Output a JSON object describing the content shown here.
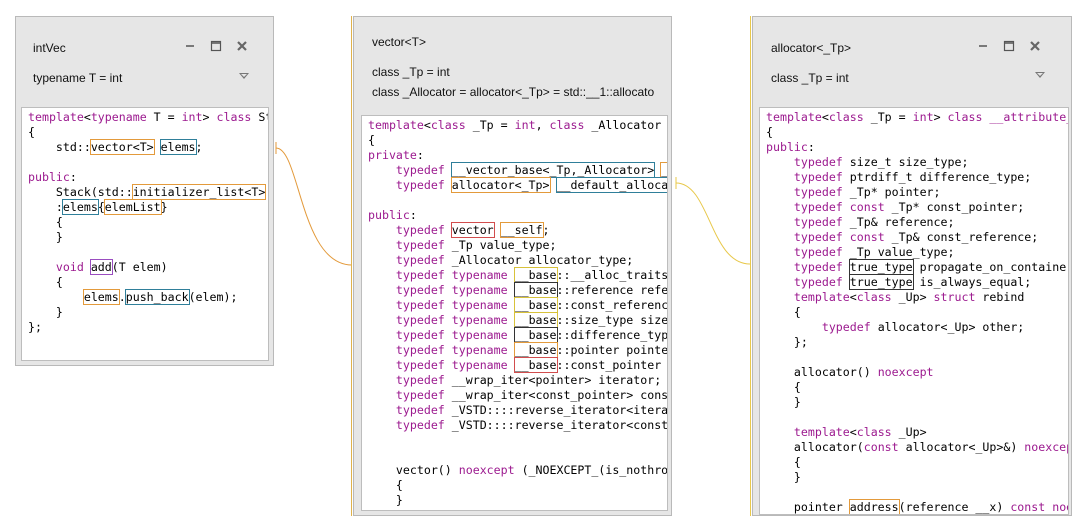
{
  "colors": {
    "panel_bg": "#e6e6e6",
    "keyword": "#9c1a8f",
    "orange_link": "#e39a3b",
    "yellow_link": "#e8c84a"
  },
  "panels": {
    "intvec": {
      "title": "intVec",
      "param": "typename T = int",
      "icons": [
        "minimize-icon",
        "maximize-icon",
        "close-icon",
        "chevron-down-icon"
      ]
    },
    "vector": {
      "title": "vector<T>",
      "params": [
        "class _Tp = int",
        "class _Allocator = allocator<_Tp> = std::__1::allocato"
      ]
    },
    "allocator": {
      "title": "allocator<_Tp>",
      "param": "class _Tp = int",
      "icons": [
        "minimize-icon",
        "maximize-icon",
        "close-icon",
        "chevron-down-icon"
      ]
    }
  },
  "code": {
    "intvec": [
      [
        [
          "template",
          "kw"
        ],
        [
          "<",
          ""
        ],
        [
          "typename",
          "kw"
        ],
        [
          " T = ",
          ""
        ],
        [
          "int",
          "kw"
        ],
        [
          "> ",
          ""
        ],
        [
          "class",
          "kw"
        ],
        [
          " Stack",
          ""
        ]
      ],
      [
        [
          "{",
          ""
        ]
      ],
      [
        [
          "    std::",
          ""
        ],
        [
          "vector<T>",
          "hl-o"
        ],
        [
          " ",
          ""
        ],
        [
          "elems",
          "hl-t"
        ],
        [
          ";",
          ""
        ]
      ],
      [
        [
          "",
          ""
        ]
      ],
      [
        [
          "public",
          "kw"
        ],
        [
          ":",
          ""
        ]
      ],
      [
        [
          "    Stack(std::",
          ""
        ],
        [
          "initializer_list<T>",
          "hl-o"
        ]
      ],
      [
        [
          "    :",
          ""
        ],
        [
          "elems",
          "hl-t"
        ],
        [
          "{",
          ""
        ],
        [
          "elemList",
          "hl-o"
        ],
        [
          "}",
          ""
        ]
      ],
      [
        [
          "    {",
          ""
        ]
      ],
      [
        [
          "    }",
          ""
        ]
      ],
      [
        [
          "",
          ""
        ]
      ],
      [
        [
          "    ",
          ""
        ],
        [
          "void",
          "kw"
        ],
        [
          " ",
          ""
        ],
        [
          "add",
          "hl-p"
        ],
        [
          "(T elem)",
          ""
        ]
      ],
      [
        [
          "    {",
          ""
        ]
      ],
      [
        [
          "        ",
          ""
        ],
        [
          "elems",
          "hl-o"
        ],
        [
          ".",
          ""
        ],
        [
          "push_back",
          "hl-t"
        ],
        [
          "(elem);",
          ""
        ]
      ],
      [
        [
          "    }",
          ""
        ]
      ],
      [
        [
          "};",
          ""
        ]
      ]
    ],
    "vector": [
      [
        [
          "template",
          "kw"
        ],
        [
          "<",
          ""
        ],
        [
          "class",
          "kw"
        ],
        [
          " _Tp = ",
          ""
        ],
        [
          "int",
          "kw"
        ],
        [
          ", ",
          ""
        ],
        [
          "class",
          "kw"
        ],
        [
          " _Allocator = allocator<_Tp>",
          ""
        ]
      ],
      [
        [
          "{",
          ""
        ]
      ],
      [
        [
          "private",
          "kw"
        ],
        [
          ":",
          ""
        ]
      ],
      [
        [
          "    ",
          ""
        ],
        [
          "typedef",
          "kw"
        ],
        [
          " ",
          ""
        ],
        [
          "__vector_base<_Tp,_Allocator>",
          "hl-t"
        ],
        [
          " ",
          ""
        ],
        [
          "__base",
          "hl-o"
        ],
        [
          ";",
          ""
        ]
      ],
      [
        [
          "    ",
          ""
        ],
        [
          "typedef",
          "kw"
        ],
        [
          " ",
          ""
        ],
        [
          "allocator<_Tp>",
          "hl-o"
        ],
        [
          " ",
          ""
        ],
        [
          "__default_allocator_type",
          "hl-t"
        ],
        [
          ";",
          ""
        ]
      ],
      [
        [
          "",
          ""
        ]
      ],
      [
        [
          "public",
          "kw"
        ],
        [
          ":",
          ""
        ]
      ],
      [
        [
          "    ",
          ""
        ],
        [
          "typedef",
          "kw"
        ],
        [
          " ",
          ""
        ],
        [
          "vector",
          "hl-r"
        ],
        [
          " ",
          ""
        ],
        [
          "__self",
          "hl-o"
        ],
        [
          ";",
          ""
        ]
      ],
      [
        [
          "    ",
          ""
        ],
        [
          "typedef",
          "kw"
        ],
        [
          " _Tp value_type;",
          ""
        ]
      ],
      [
        [
          "    ",
          ""
        ],
        [
          "typedef",
          "kw"
        ],
        [
          " _Allocator allocator_type;",
          ""
        ]
      ],
      [
        [
          "    ",
          ""
        ],
        [
          "typedef",
          "kw"
        ],
        [
          " ",
          ""
        ],
        [
          "typename",
          "kw"
        ],
        [
          " ",
          ""
        ],
        [
          "__base",
          "hl-y"
        ],
        [
          "::__alloc_traits __alloc_traits;",
          ""
        ]
      ],
      [
        [
          "    ",
          ""
        ],
        [
          "typedef",
          "kw"
        ],
        [
          " ",
          ""
        ],
        [
          "typename",
          "kw"
        ],
        [
          " ",
          ""
        ],
        [
          "__base",
          "hl-k"
        ],
        [
          "::reference reference;",
          ""
        ]
      ],
      [
        [
          "    ",
          ""
        ],
        [
          "typedef",
          "kw"
        ],
        [
          " ",
          ""
        ],
        [
          "typename",
          "kw"
        ],
        [
          " ",
          ""
        ],
        [
          "__base",
          "hl-y"
        ],
        [
          "::const_reference const_reference;",
          ""
        ]
      ],
      [
        [
          "    ",
          ""
        ],
        [
          "typedef",
          "kw"
        ],
        [
          " ",
          ""
        ],
        [
          "typename",
          "kw"
        ],
        [
          " ",
          ""
        ],
        [
          "__base",
          "hl-y"
        ],
        [
          "::size_type size_type;",
          ""
        ]
      ],
      [
        [
          "    ",
          ""
        ],
        [
          "typedef",
          "kw"
        ],
        [
          " ",
          ""
        ],
        [
          "typename",
          "kw"
        ],
        [
          " ",
          ""
        ],
        [
          "__base",
          "hl-k"
        ],
        [
          "::difference_type difference_type;",
          ""
        ]
      ],
      [
        [
          "    ",
          ""
        ],
        [
          "typedef",
          "kw"
        ],
        [
          " ",
          ""
        ],
        [
          "typename",
          "kw"
        ],
        [
          " ",
          ""
        ],
        [
          "__base",
          "hl-o"
        ],
        [
          "::pointer pointer;",
          ""
        ]
      ],
      [
        [
          "    ",
          ""
        ],
        [
          "typedef",
          "kw"
        ],
        [
          " ",
          ""
        ],
        [
          "typename",
          "kw"
        ],
        [
          " ",
          ""
        ],
        [
          "__base",
          "hl-r"
        ],
        [
          "::const_pointer const_pointer;",
          ""
        ]
      ],
      [
        [
          "    ",
          ""
        ],
        [
          "typedef",
          "kw"
        ],
        [
          " __wrap_iter<pointer> iterator;",
          ""
        ]
      ],
      [
        [
          "    ",
          ""
        ],
        [
          "typedef",
          "kw"
        ],
        [
          " __wrap_iter<const_pointer> const_iterator;",
          ""
        ]
      ],
      [
        [
          "    ",
          ""
        ],
        [
          "typedef",
          "kw"
        ],
        [
          " _VSTD::::reverse_iterator<iterator> reverse_iterator;",
          ""
        ]
      ],
      [
        [
          "    ",
          ""
        ],
        [
          "typedef",
          "kw"
        ],
        [
          " _VSTD::::reverse_iterator<const_iterator> const_reverse_iterator;",
          ""
        ]
      ],
      [
        [
          "",
          ""
        ]
      ],
      [
        [
          "",
          ""
        ]
      ],
      [
        [
          "    vector() ",
          ""
        ],
        [
          "noexcept",
          "kw"
        ],
        [
          " (_NOEXCEPT_(is_nothrow_default_constructible",
          ""
        ]
      ],
      [
        [
          "    {",
          ""
        ]
      ],
      [
        [
          "    }",
          ""
        ]
      ]
    ],
    "allocator": [
      [
        [
          "template",
          "kw"
        ],
        [
          "<",
          ""
        ],
        [
          "class",
          "kw"
        ],
        [
          " _Tp = ",
          ""
        ],
        [
          "int",
          "kw"
        ],
        [
          "> ",
          ""
        ],
        [
          "class",
          "kw"
        ],
        [
          " ",
          ""
        ],
        [
          "__attribute__",
          "kw"
        ]
      ],
      [
        [
          "{",
          ""
        ]
      ],
      [
        [
          "public",
          "kw"
        ],
        [
          ":",
          ""
        ]
      ],
      [
        [
          "    ",
          ""
        ],
        [
          "typedef",
          "kw"
        ],
        [
          " size_t size_type;",
          ""
        ]
      ],
      [
        [
          "    ",
          ""
        ],
        [
          "typedef",
          "kw"
        ],
        [
          " ptrdiff_t difference_type;",
          ""
        ]
      ],
      [
        [
          "    ",
          ""
        ],
        [
          "typedef",
          "kw"
        ],
        [
          " _Tp* pointer;",
          ""
        ]
      ],
      [
        [
          "    ",
          ""
        ],
        [
          "typedef",
          "kw"
        ],
        [
          " ",
          ""
        ],
        [
          "const",
          "kw"
        ],
        [
          " _Tp* const_pointer;",
          ""
        ]
      ],
      [
        [
          "    ",
          ""
        ],
        [
          "typedef",
          "kw"
        ],
        [
          " _Tp& reference;",
          ""
        ]
      ],
      [
        [
          "    ",
          ""
        ],
        [
          "typedef",
          "kw"
        ],
        [
          " ",
          ""
        ],
        [
          "const",
          "kw"
        ],
        [
          " _Tp& const_reference;",
          ""
        ]
      ],
      [
        [
          "    ",
          ""
        ],
        [
          "typedef",
          "kw"
        ],
        [
          " _Tp value_type;",
          ""
        ]
      ],
      [
        [
          "    ",
          ""
        ],
        [
          "typedef",
          "kw"
        ],
        [
          " ",
          ""
        ],
        [
          "true_type",
          "hl-k"
        ],
        [
          " propagate_on_container_move_assignment;",
          ""
        ]
      ],
      [
        [
          "    ",
          ""
        ],
        [
          "typedef",
          "kw"
        ],
        [
          " ",
          ""
        ],
        [
          "true_type",
          "hl-k"
        ],
        [
          " is_always_equal;",
          ""
        ]
      ],
      [
        [
          "    ",
          ""
        ],
        [
          "template",
          "kw"
        ],
        [
          "<",
          ""
        ],
        [
          "class",
          "kw"
        ],
        [
          " _Up> ",
          ""
        ],
        [
          "struct",
          "kw"
        ],
        [
          " rebind",
          ""
        ]
      ],
      [
        [
          "    {",
          ""
        ]
      ],
      [
        [
          "        ",
          ""
        ],
        [
          "typedef",
          "kw"
        ],
        [
          " allocator<_Up> other;",
          ""
        ]
      ],
      [
        [
          "    };",
          ""
        ]
      ],
      [
        [
          "",
          ""
        ]
      ],
      [
        [
          "    allocator() ",
          ""
        ],
        [
          "noexcept",
          "kw"
        ]
      ],
      [
        [
          "    {",
          ""
        ]
      ],
      [
        [
          "    }",
          ""
        ]
      ],
      [
        [
          "",
          ""
        ]
      ],
      [
        [
          "    ",
          ""
        ],
        [
          "template",
          "kw"
        ],
        [
          "<",
          ""
        ],
        [
          "class",
          "kw"
        ],
        [
          " _Up>",
          ""
        ]
      ],
      [
        [
          "    allocator(",
          ""
        ],
        [
          "const",
          "kw"
        ],
        [
          " allocator<_Up>&) ",
          ""
        ],
        [
          "noexcept",
          "kw"
        ]
      ],
      [
        [
          "    {",
          ""
        ]
      ],
      [
        [
          "    }",
          ""
        ]
      ],
      [
        [
          "",
          ""
        ]
      ],
      [
        [
          "    pointer ",
          ""
        ],
        [
          "address",
          "hl-o"
        ],
        [
          "(reference __x) ",
          ""
        ],
        [
          "const",
          "kw"
        ],
        [
          " ",
          ""
        ],
        [
          "noexcept",
          "kw"
        ]
      ]
    ]
  }
}
